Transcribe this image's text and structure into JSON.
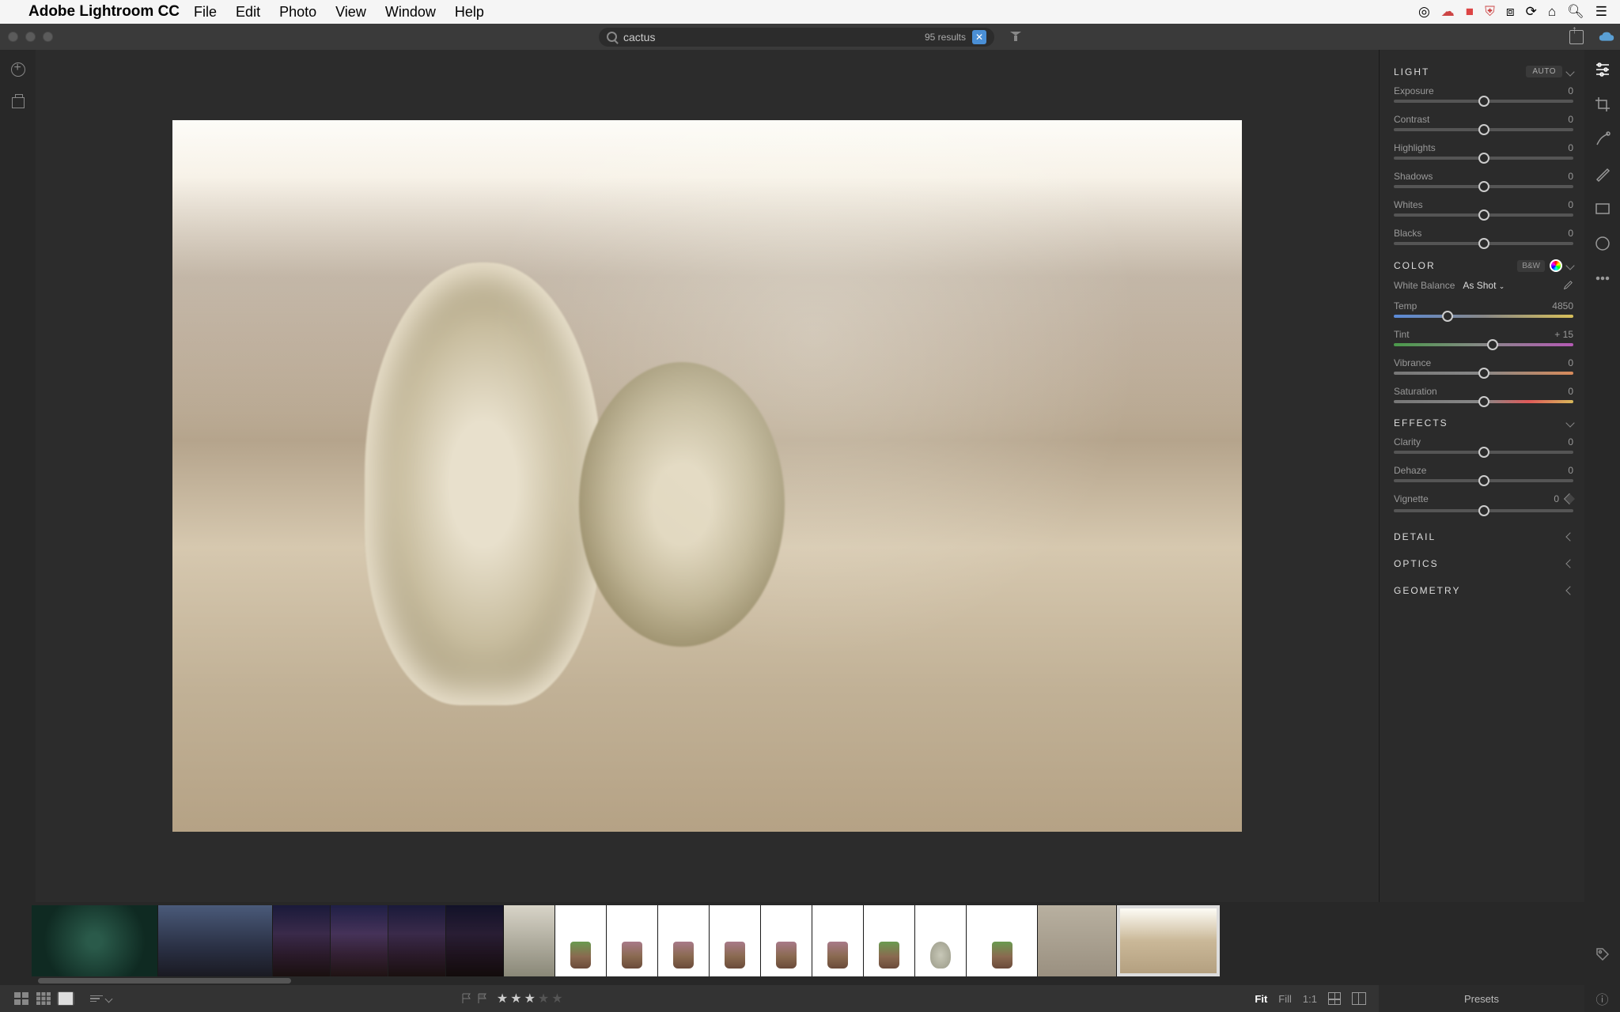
{
  "menubar": {
    "app_name": "Adobe Lightroom CC",
    "items": [
      "File",
      "Edit",
      "Photo",
      "View",
      "Window",
      "Help"
    ]
  },
  "header": {
    "search_query": "cactus",
    "results_text": "95 results"
  },
  "edit": {
    "light": {
      "title": "LIGHT",
      "auto": "AUTO",
      "sliders": [
        {
          "label": "Exposure",
          "value": "0",
          "pos": 50
        },
        {
          "label": "Contrast",
          "value": "0",
          "pos": 50
        },
        {
          "label": "Highlights",
          "value": "0",
          "pos": 50
        },
        {
          "label": "Shadows",
          "value": "0",
          "pos": 50
        },
        {
          "label": "Whites",
          "value": "0",
          "pos": 50
        },
        {
          "label": "Blacks",
          "value": "0",
          "pos": 50
        }
      ]
    },
    "color": {
      "title": "COLOR",
      "bw": "B&W",
      "wb_label": "White Balance",
      "wb_value": "As Shot",
      "sliders": [
        {
          "label": "Temp",
          "value": "4850",
          "pos": 30,
          "track": "temp"
        },
        {
          "label": "Tint",
          "value": "+ 15",
          "pos": 55,
          "track": "tint"
        },
        {
          "label": "Vibrance",
          "value": "0",
          "pos": 50,
          "track": "vib"
        },
        {
          "label": "Saturation",
          "value": "0",
          "pos": 50,
          "track": "sat"
        }
      ]
    },
    "effects": {
      "title": "EFFECTS",
      "sliders": [
        {
          "label": "Clarity",
          "value": "0",
          "pos": 50
        },
        {
          "label": "Dehaze",
          "value": "0",
          "pos": 50
        }
      ],
      "vignette": {
        "label": "Vignette",
        "value": "0",
        "pos": 50
      }
    },
    "detail_title": "DETAIL",
    "optics_title": "OPTICS",
    "geometry_title": "GEOMETRY"
  },
  "bottom": {
    "stars_filled": 3,
    "fit": "Fit",
    "fill": "Fill",
    "one_to_one": "1:1",
    "presets": "Presets"
  }
}
